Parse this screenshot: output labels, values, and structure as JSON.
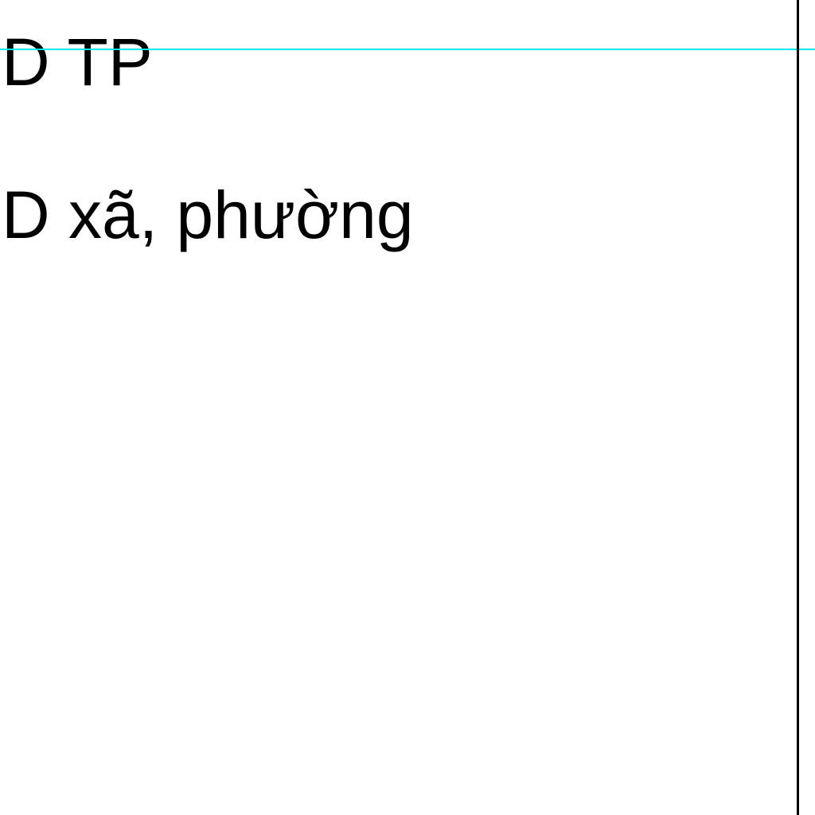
{
  "labels": {
    "line1": "D TP",
    "line2": "D xã, phường"
  },
  "colors": {
    "guide_line": "#00e5ee",
    "border_line": "#000000",
    "text": "#000000",
    "background": "#ffffff"
  }
}
